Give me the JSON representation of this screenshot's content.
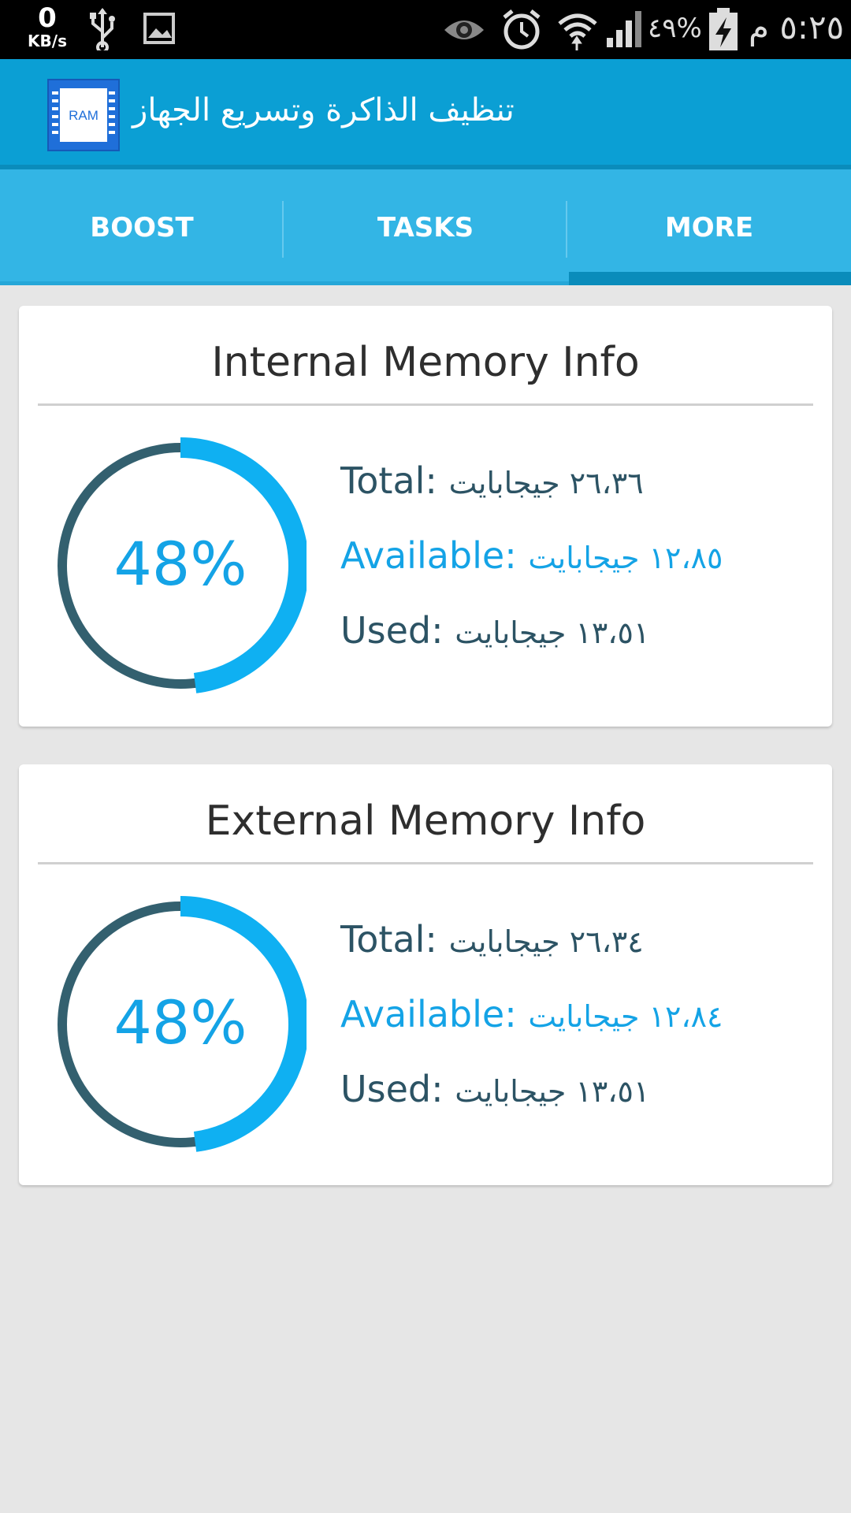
{
  "status_bar": {
    "net_speed_value": "0",
    "net_speed_unit": "KB/s",
    "battery_percent": "٤٩%",
    "clock": "٥:٢٥ م",
    "icons": [
      "usb-icon",
      "image-icon",
      "eye-icon",
      "alarm-icon",
      "wifi-icon",
      "signal-icon",
      "battery-charging-icon"
    ]
  },
  "action_bar": {
    "app_icon_text": "RAM",
    "title": "تنظيف الذاكرة وتسريع الجهاز"
  },
  "tabs": [
    {
      "label": "BOOST",
      "selected": false
    },
    {
      "label": "TASKS",
      "selected": false
    },
    {
      "label": "MORE",
      "selected": true
    }
  ],
  "internal_memory": {
    "title": "Internal Memory Info",
    "percent_label": "48%",
    "percent_value": 48,
    "total_label": "Total:",
    "total_value": "٢٦،٣٦ جيجابايت",
    "available_label": "Available:",
    "available_value": "١٢،٨٥ جيجابايت",
    "used_label": "Used:",
    "used_value": "١٣،٥١ جيجابايت"
  },
  "external_memory": {
    "title": "External Memory Info",
    "percent_label": "48%",
    "percent_value": 48,
    "total_label": "Total:",
    "total_value": "٢٦،٣٤ جيجابايت",
    "available_label": "Available:",
    "available_value": "١٢،٨٤ جيجابايت",
    "used_label": "Used:",
    "used_value": "١٣،٥١ جيجابايت"
  },
  "colors": {
    "action_bar": "#0b9fd4",
    "tab_bar": "#33b5e5",
    "gauge_used": "#0fb0f2",
    "gauge_track": "#33606f",
    "accent_text": "#14a3e6",
    "dark_text": "#2c5364",
    "background": "#e6e6e6"
  }
}
